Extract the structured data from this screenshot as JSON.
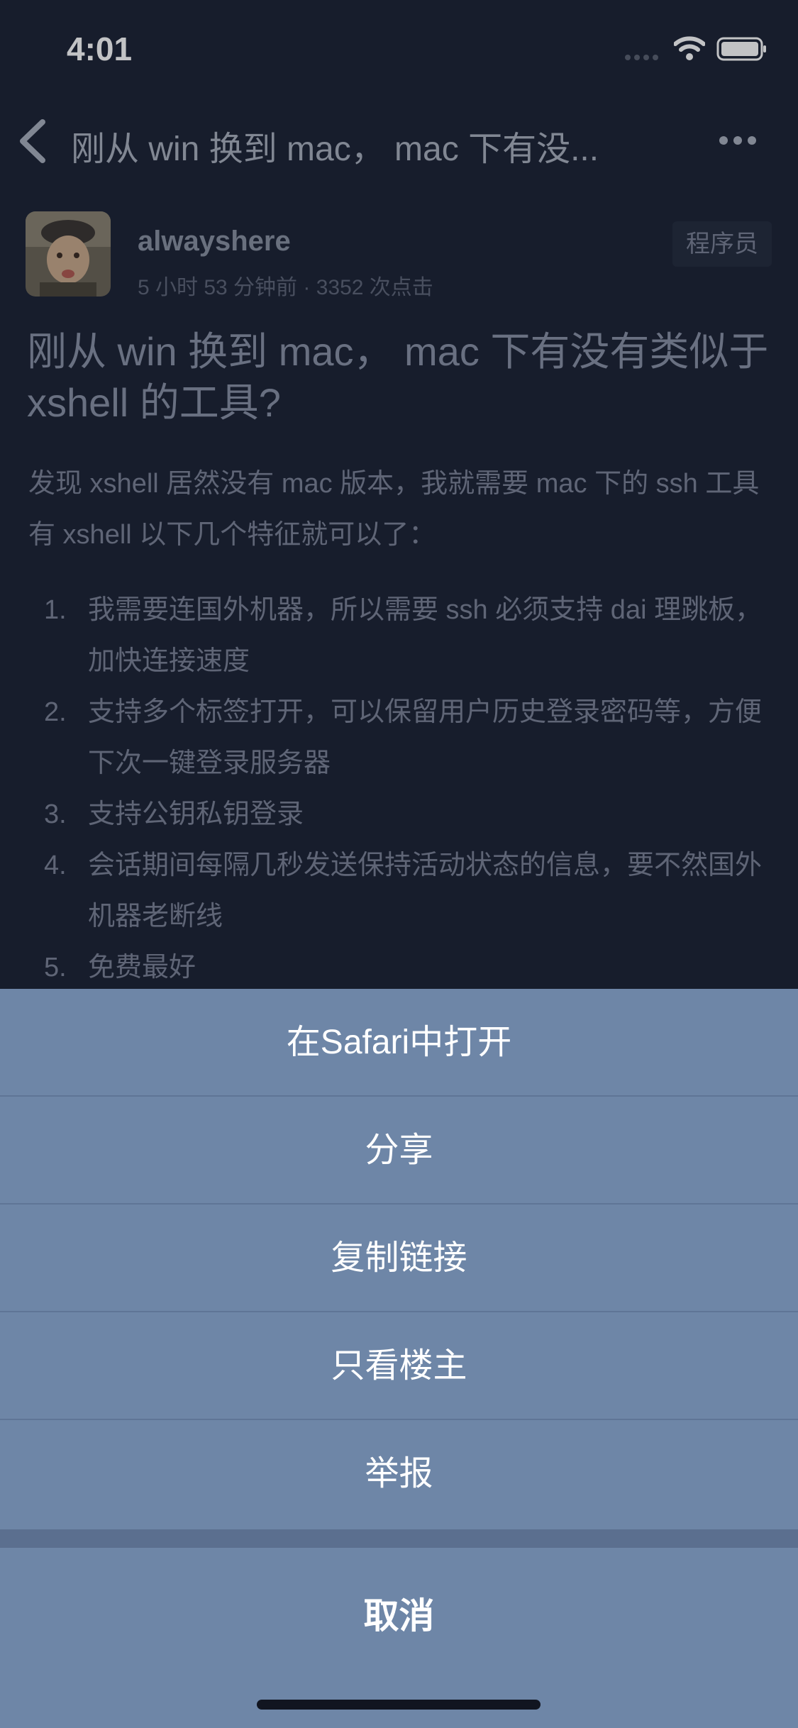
{
  "status_bar": {
    "time": "4:01"
  },
  "nav": {
    "title": "刚从 win 换到 mac， mac 下有没..."
  },
  "post": {
    "author": "alwayshere",
    "meta": "5 小时 53 分钟前 · 3352 次点击",
    "node": "程序员",
    "title": "刚从 win 换到 mac， mac 下有没有类似于 xshell 的工具?",
    "intro": "发现 xshell 居然没有 mac 版本，我就需要 mac 下的 ssh 工具有 xshell 以下几个特征就可以了：",
    "requirements": [
      {
        "num": "1.",
        "text": "我需要连国外机器，所以需要 ssh 必须支持 dai 理跳板，加快连接速度"
      },
      {
        "num": "2.",
        "text": "支持多个标签打开，可以保留用户历史登录密码等，方便下次一键登录服务器"
      },
      {
        "num": "3.",
        "text": "支持公钥私钥登录"
      },
      {
        "num": "4.",
        "text": "会话期间每隔几秒发送保持活动状态的信息，要不然国外机器老断线"
      },
      {
        "num": "5.",
        "text": "免费最好"
      }
    ]
  },
  "action_sheet": {
    "items": [
      {
        "label": "在Safari中打开"
      },
      {
        "label": "分享"
      },
      {
        "label": "复制链接"
      },
      {
        "label": "只看楼主"
      },
      {
        "label": "举报"
      }
    ],
    "cancel": "取消"
  },
  "colors": {
    "background": "#1b2233",
    "sheet": "#6e86a7",
    "sheet_text": "#ffffff"
  }
}
